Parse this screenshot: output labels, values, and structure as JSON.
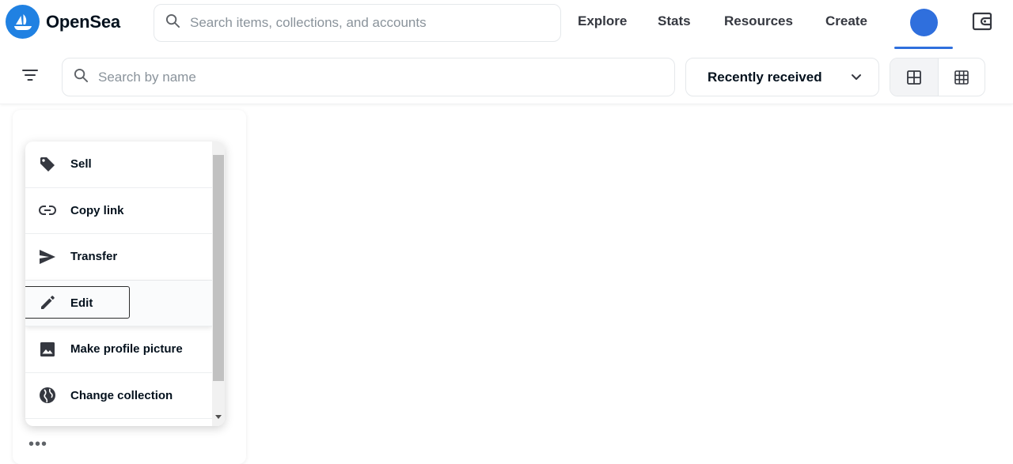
{
  "app": {
    "brand": "OpenSea",
    "brand_color": "#2081e2",
    "accent_color": "#2f6fdd"
  },
  "header": {
    "search_placeholder": "Search items, collections, and accounts",
    "nav": [
      "Explore",
      "Stats",
      "Resources",
      "Create"
    ],
    "icons": [
      "search-icon",
      "avatar",
      "wallet-icon"
    ]
  },
  "toolbar": {
    "name_search_placeholder": "Search by name",
    "sort_selected": "Recently received",
    "view_modes": [
      "large-grid-icon",
      "small-grid-icon"
    ],
    "active_view": "large-grid"
  },
  "context_menu": {
    "items": [
      {
        "label": "Sell",
        "icon": "tag-icon"
      },
      {
        "label": "Copy link",
        "icon": "link-icon"
      },
      {
        "label": "Transfer",
        "icon": "send-icon"
      },
      {
        "label": "Edit",
        "icon": "pencil-icon",
        "state": "focused"
      },
      {
        "label": "Make profile picture",
        "icon": "image-icon"
      },
      {
        "label": "Change collection",
        "icon": "collection-icon"
      }
    ]
  },
  "card": {
    "more_label": "•••"
  }
}
